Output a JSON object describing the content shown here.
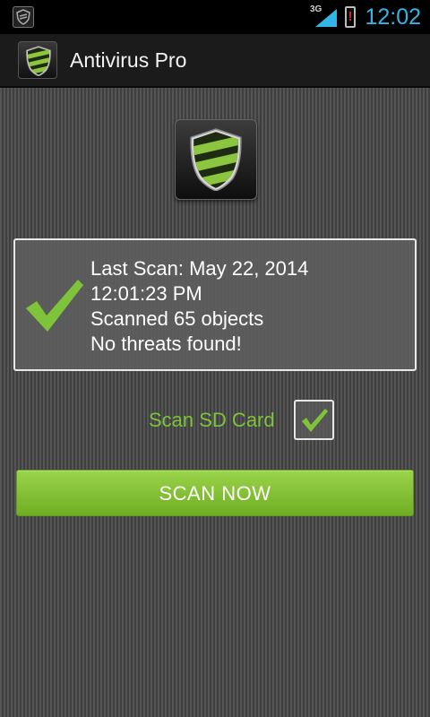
{
  "status_bar": {
    "network": "3G",
    "time": "12:02",
    "icons": [
      "app-notification-icon",
      "signal-icon",
      "battery-alert-icon"
    ]
  },
  "action_bar": {
    "title": "Antivirus Pro",
    "icon": "shield-logo-icon"
  },
  "hero": {
    "icon": "shield-logo-icon"
  },
  "scan_result": {
    "icon": "check-icon",
    "lines": [
      "Last Scan: May 22, 2014",
      "12:01:23 PM",
      "Scanned 65 objects",
      "No threats found!"
    ]
  },
  "options": {
    "scan_sd_label": "Scan SD Card",
    "scan_sd_checked": true
  },
  "scan_button": {
    "label": "SCAN NOW"
  },
  "colors": {
    "accent_green": "#7ec33a",
    "button_green": "#8bc53f",
    "clock_blue": "#33b5e5"
  }
}
